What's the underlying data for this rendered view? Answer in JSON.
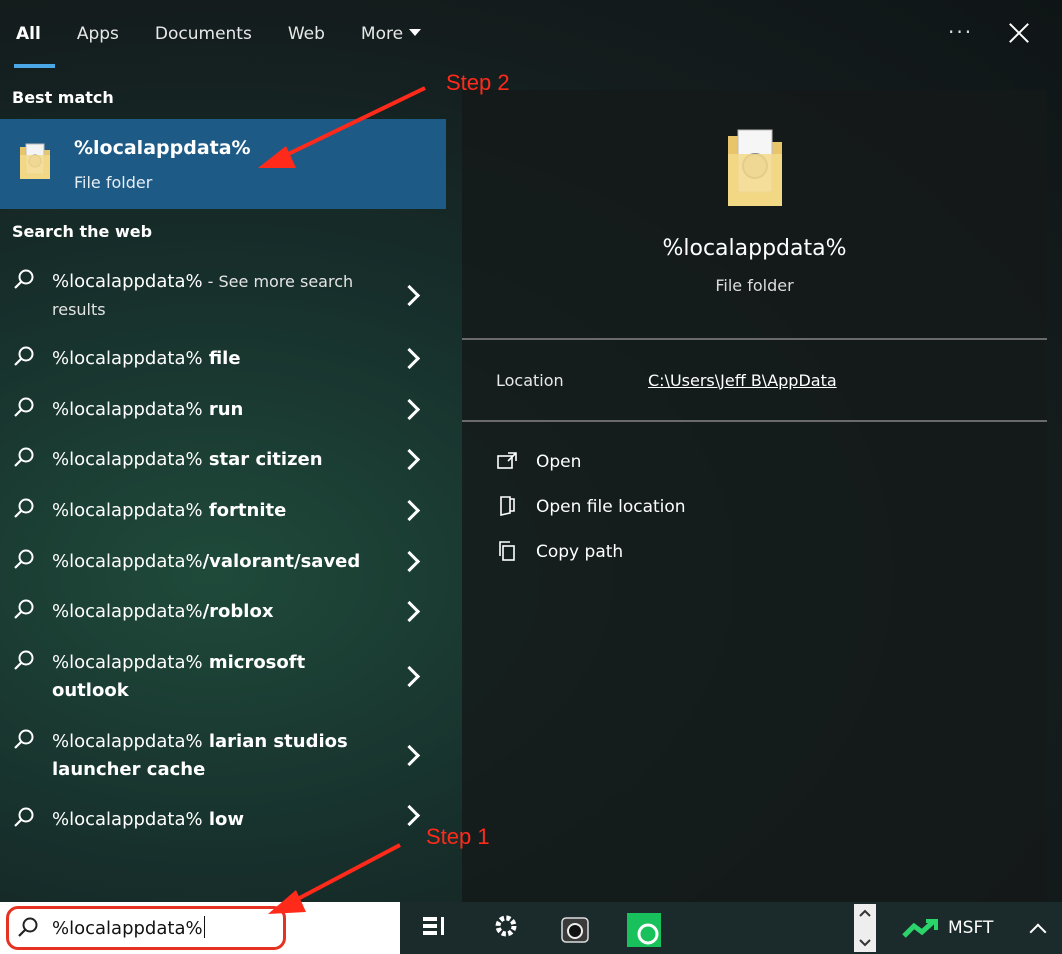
{
  "tabs": [
    {
      "label": "All",
      "active": true
    },
    {
      "label": "Apps",
      "active": false
    },
    {
      "label": "Documents",
      "active": false
    },
    {
      "label": "Web",
      "active": false
    },
    {
      "label": "More",
      "active": false
    }
  ],
  "header": {
    "more_options": "···"
  },
  "best_match": {
    "title": "Best match",
    "name": "%localappdata%",
    "type": "File folder"
  },
  "web": {
    "title": "Search the web",
    "items": [
      {
        "query": "%localappdata%",
        "suffix": "",
        "note": " - See more search results"
      },
      {
        "query": "%localappdata%",
        "suffix": " file",
        "note": ""
      },
      {
        "query": "%localappdata%",
        "suffix": " run",
        "note": ""
      },
      {
        "query": "%localappdata%",
        "suffix": " star citizen",
        "note": ""
      },
      {
        "query": "%localappdata%",
        "suffix": " fortnite",
        "note": ""
      },
      {
        "query": "%localappdata%",
        "suffix": "/valorant/saved",
        "note": ""
      },
      {
        "query": "%localappdata%",
        "suffix": "/roblox",
        "note": ""
      },
      {
        "query": "%localappdata%",
        "suffix": " microsoft outlook",
        "note": ""
      },
      {
        "query": "%localappdata%",
        "suffix": " larian studios launcher cache",
        "note": ""
      },
      {
        "query": "%localappdata%",
        "suffix": " low",
        "note": ""
      }
    ]
  },
  "preview": {
    "name": "%localappdata%",
    "type": "File folder",
    "location_label": "Location",
    "location_value": "C:\\Users\\Jeff B\\AppData",
    "actions": [
      {
        "label": "Open",
        "icon": "open-window-icon"
      },
      {
        "label": "Open file location",
        "icon": "file-location-icon"
      },
      {
        "label": "Copy path",
        "icon": "copy-icon"
      }
    ]
  },
  "search": {
    "value": "%localappdata%"
  },
  "taskbar": {
    "stock_label": "MSFT"
  },
  "annotations": {
    "step1": "Step 1",
    "step2": "Step 2"
  },
  "colors": {
    "accent": "#4aa8e6",
    "selection": "#1d5a86",
    "annotation": "#ff2a1a"
  }
}
